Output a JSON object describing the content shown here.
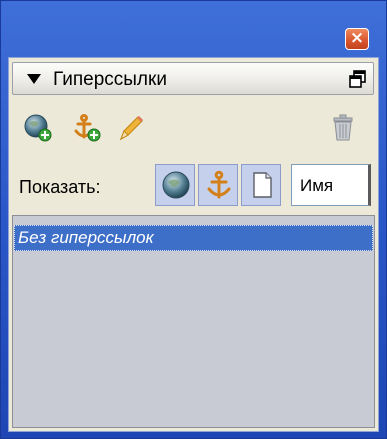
{
  "window": {
    "close_label": "×",
    "accent_color": "#2a57c8"
  },
  "panel": {
    "title": "Гиперссылки"
  },
  "toolbar": {
    "icons": [
      "new-link-globe-plus-icon",
      "new-anchor-plus-icon",
      "edit-pencil-icon",
      "delete-trash-icon"
    ]
  },
  "filter": {
    "label": "Показать:",
    "buttons": [
      "globe-icon",
      "anchor-icon",
      "page-icon"
    ],
    "sort_value": "Имя"
  },
  "list": {
    "items": [
      "Без гиперссылок"
    ],
    "selected_color": "#3d6fc9"
  }
}
